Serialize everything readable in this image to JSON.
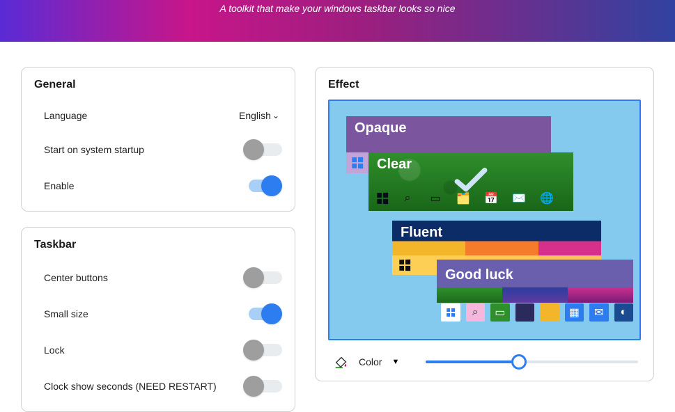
{
  "header": {
    "tagline": "A toolkit that make your windows taskbar looks so nice"
  },
  "general": {
    "title": "General",
    "language_label": "Language",
    "language_value": "English",
    "startup_label": "Start on system startup",
    "startup_on": false,
    "enable_label": "Enable",
    "enable_on": true
  },
  "taskbar": {
    "title": "Taskbar",
    "center_label": "Center buttons",
    "center_on": false,
    "small_label": "Small size",
    "small_on": true,
    "lock_label": "Lock",
    "lock_on": false,
    "clock_label": "Clock show seconds (NEED RESTART)",
    "clock_on": false
  },
  "effect": {
    "title": "Effect",
    "options": {
      "opaque": "Opaque",
      "clear": "Clear",
      "fluent": "Fluent",
      "goodluck": "Good luck"
    },
    "selected": "clear",
    "color_label": "Color",
    "slider_value": 44
  },
  "colors": {
    "accent": "#2d7cf0",
    "opaque_bg": "#7b569f",
    "fluent_bg": "#6a5fad"
  }
}
